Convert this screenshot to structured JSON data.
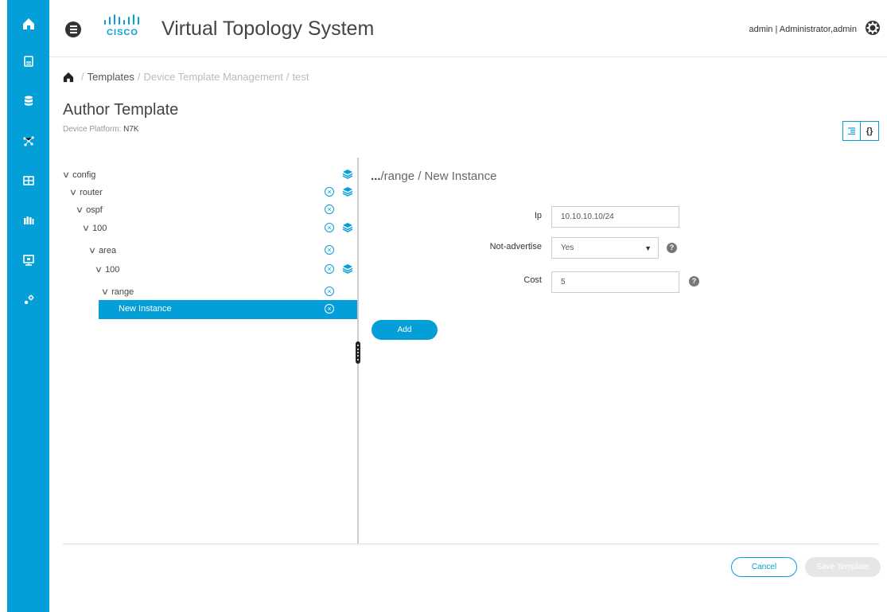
{
  "colors": {
    "accent": "#049fd9",
    "rail": "#049fd9",
    "disabled": "#e6e6e6"
  },
  "rail": {
    "items": [
      {
        "icon": "home-icon"
      },
      {
        "icon": "document-icon"
      },
      {
        "icon": "database-icon"
      },
      {
        "icon": "topology-icon"
      },
      {
        "icon": "grid-icon"
      },
      {
        "icon": "inventory-icon"
      },
      {
        "icon": "monitor-icon"
      },
      {
        "icon": "admin-tools-icon"
      }
    ]
  },
  "header": {
    "logo_text": "CISCO",
    "title": "Virtual Topology System",
    "user": "admin | Administrator,admin"
  },
  "breadcrumb": {
    "items": [
      "Templates",
      "Device Template Management",
      "test"
    ]
  },
  "page": {
    "title": "Author Template",
    "platform_label": "Device Platform:",
    "platform_value": "N7K"
  },
  "tree": {
    "nodes": [
      {
        "label": "config",
        "remove": false,
        "layers": true
      },
      {
        "label": "router",
        "remove": true,
        "layers": true
      },
      {
        "label": "ospf",
        "remove": true,
        "layers": false
      },
      {
        "label": "100",
        "remove": true,
        "layers": true
      },
      {
        "label": "area",
        "remove": true,
        "layers": false
      },
      {
        "label": "100",
        "remove": true,
        "layers": true
      },
      {
        "label": "range",
        "remove": true,
        "layers": false
      },
      {
        "label": "New Instance",
        "remove": true,
        "layers": false,
        "selected": true
      }
    ]
  },
  "detail": {
    "path_prefix": "...",
    "path": "/range / New Instance",
    "fields": {
      "ip": {
        "label": "Ip",
        "value": "10.10.10.10/24"
      },
      "not_advertise": {
        "label": "Not-advertise",
        "value": "Yes"
      },
      "cost": {
        "label": "Cost",
        "value": "5"
      }
    },
    "add_label": "Add"
  },
  "footer": {
    "cancel_label": "Cancel",
    "save_label": "Save Template"
  }
}
